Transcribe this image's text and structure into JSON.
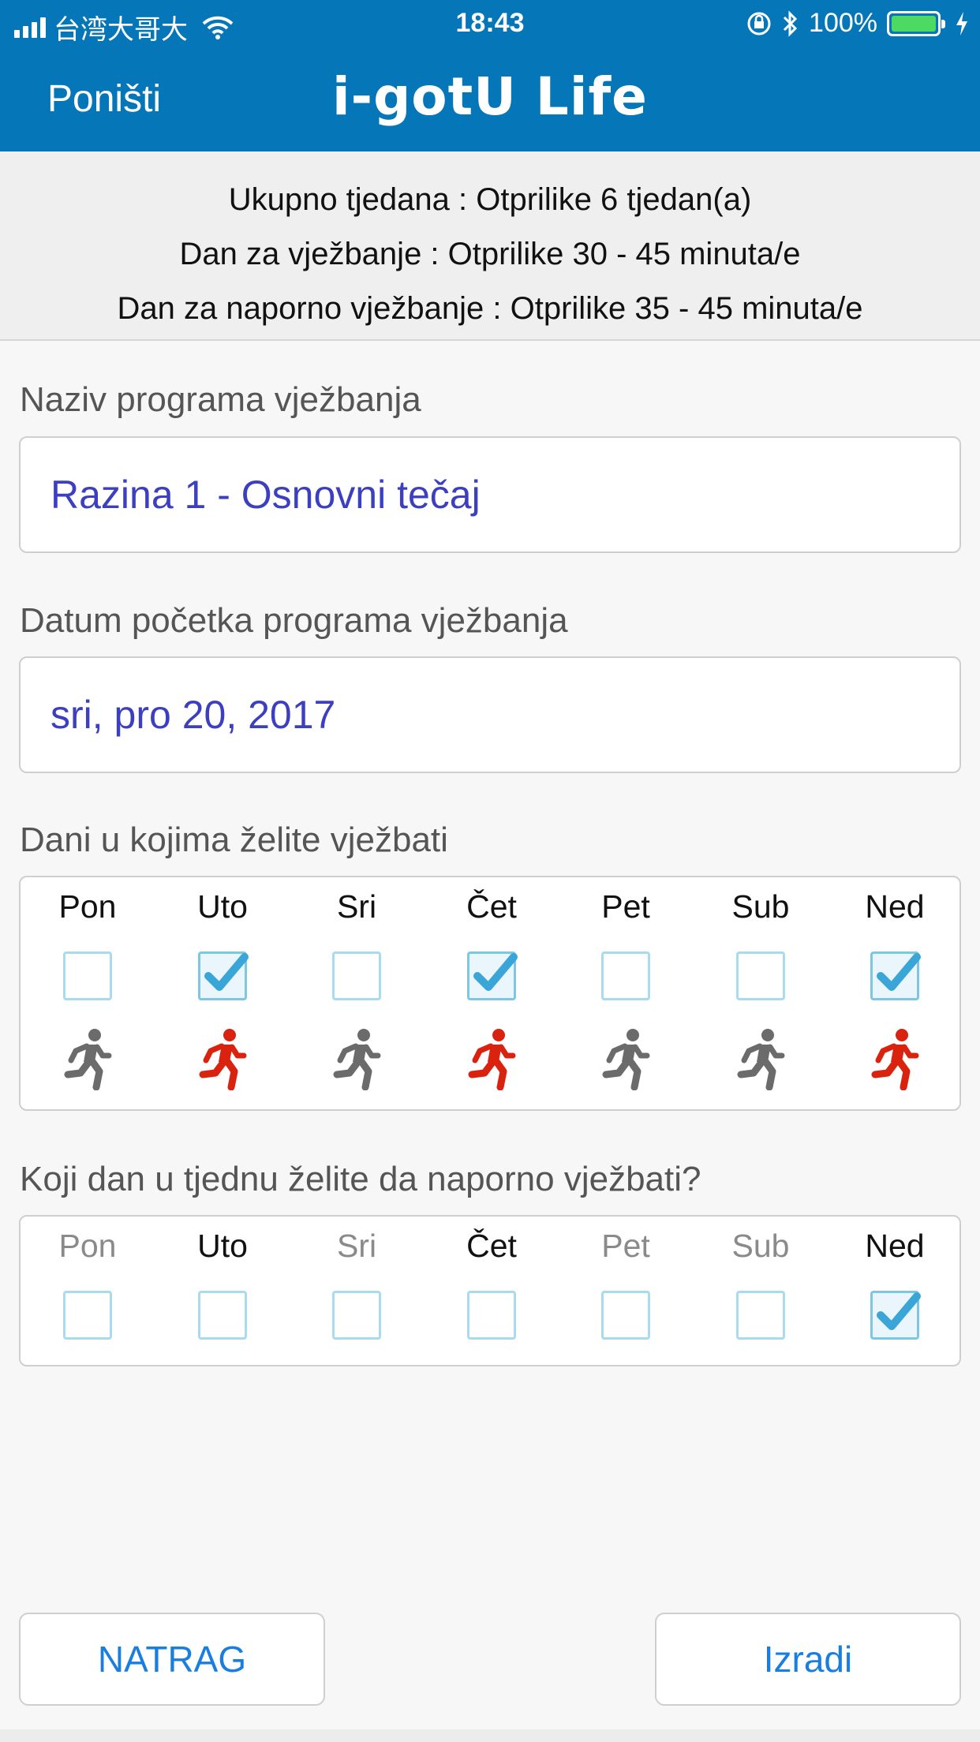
{
  "status_bar": {
    "carrier": "台湾大哥大",
    "time": "18:43",
    "battery": "100%"
  },
  "nav": {
    "cancel_label": "Poništi",
    "title": "i-gotU Life"
  },
  "summary": {
    "line1": "Ukupno tjedana : Otprilike 6 tjedan(a)",
    "line2": "Dan za vježbanje : Otprilike 30 - 45 minuta/e",
    "line3": "Dan za naporno vježbanje : Otprilike 35 - 45 minuta/e"
  },
  "program_name": {
    "label": "Naziv programa vježbanja",
    "value": "Razina 1 - Osnovni tečaj"
  },
  "start_date": {
    "label": "Datum početka programa vježbanja",
    "value": "sri, pro 20, 2017"
  },
  "training_days": {
    "label": "Dani u kojima želite vježbati",
    "days": [
      {
        "name": "Pon",
        "checked": false
      },
      {
        "name": "Uto",
        "checked": true
      },
      {
        "name": "Sri",
        "checked": false
      },
      {
        "name": "Čet",
        "checked": true
      },
      {
        "name": "Pet",
        "checked": false
      },
      {
        "name": "Sub",
        "checked": false
      },
      {
        "name": "Ned",
        "checked": true
      }
    ],
    "active_color": "#d9230f",
    "inactive_color": "#6b6b6b"
  },
  "hard_days": {
    "label": "Koji dan u tjednu želite da naporno vježbati?",
    "days": [
      {
        "name": "Pon",
        "enabled": false,
        "checked": false
      },
      {
        "name": "Uto",
        "enabled": true,
        "checked": false
      },
      {
        "name": "Sri",
        "enabled": false,
        "checked": false
      },
      {
        "name": "Čet",
        "enabled": true,
        "checked": false
      },
      {
        "name": "Pet",
        "enabled": false,
        "checked": false
      },
      {
        "name": "Sub",
        "enabled": false,
        "checked": false
      },
      {
        "name": "Ned",
        "enabled": true,
        "checked": true
      }
    ]
  },
  "buttons": {
    "back_label": "NATRAG",
    "create_label": "Izradi"
  },
  "colors": {
    "nav_blue": "#0577b8",
    "value_text": "#3b3fc0",
    "button_text": "#1a7ee0",
    "check_blue": "#3aa6d8"
  }
}
